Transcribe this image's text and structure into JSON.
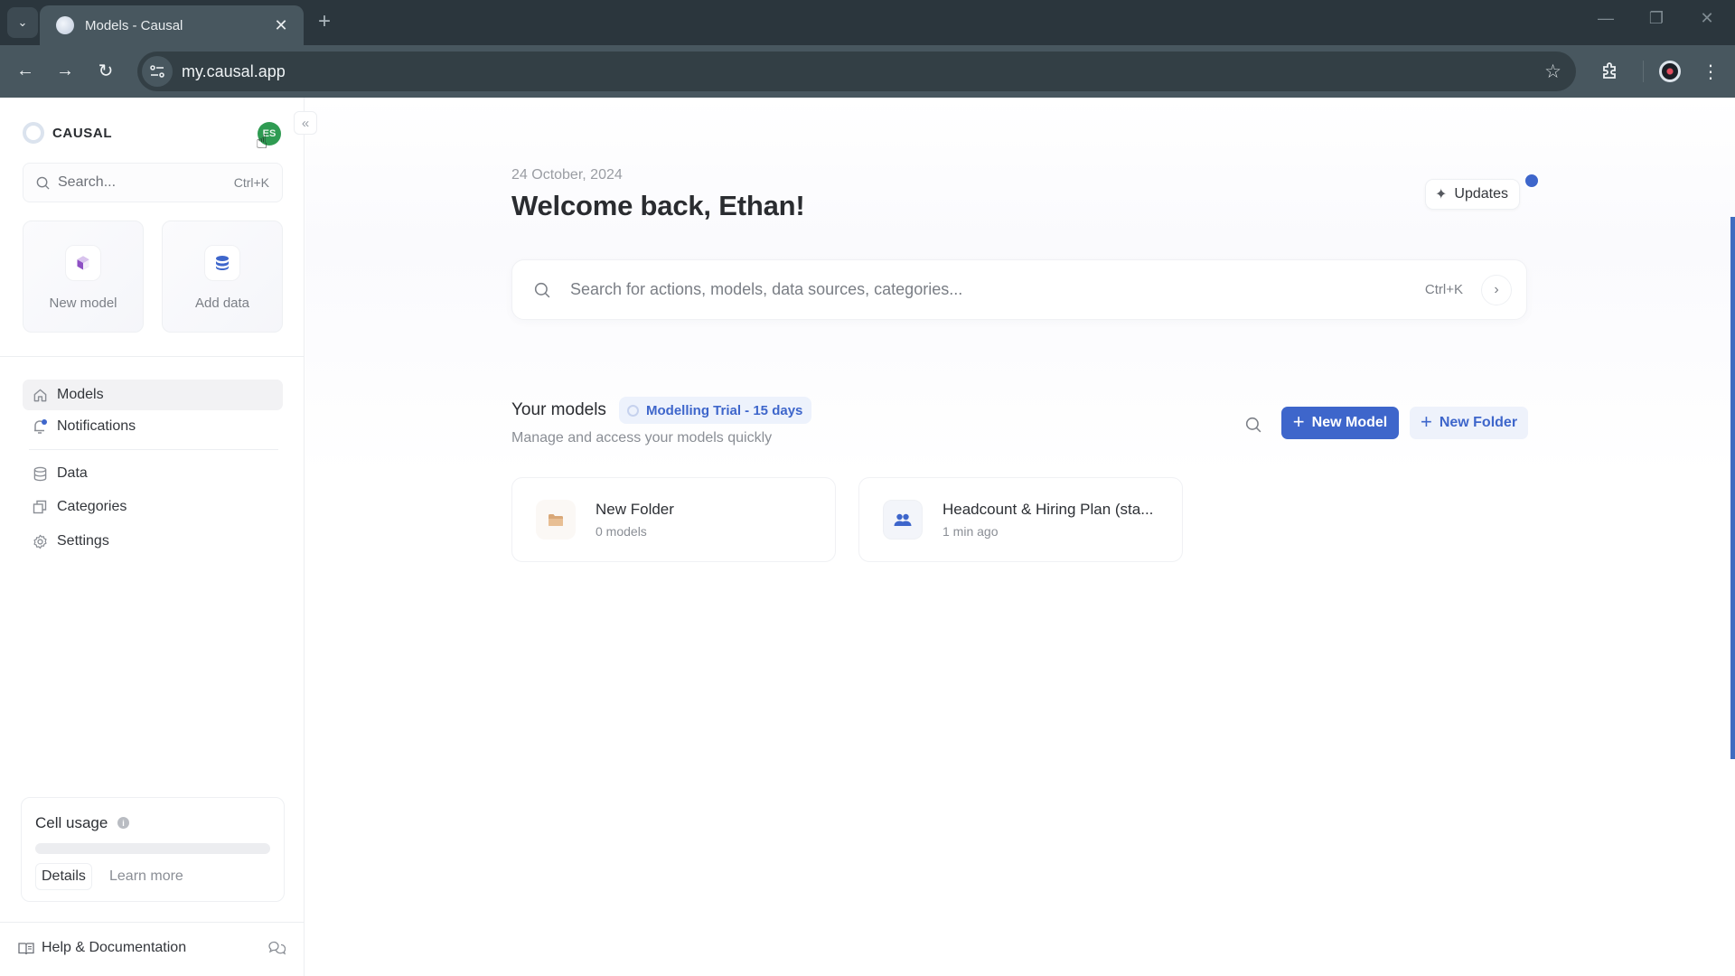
{
  "browser": {
    "tab_title": "Models - Causal",
    "url": "my.causal.app",
    "icons": {
      "tab_list": "chevron-down-icon",
      "close_tab": "close-icon",
      "new_tab": "plus-icon",
      "back": "arrow-left-icon",
      "forward": "arrow-right-icon",
      "reload": "reload-icon",
      "site_info": "tune-icon",
      "bookmark": "star-icon",
      "extensions": "puzzle-icon",
      "profile": "profile-icon",
      "menu": "kebab-menu-icon",
      "minimize": "minimize-icon",
      "restore": "restore-icon",
      "close_window": "close-icon"
    }
  },
  "sidebar": {
    "brand": "CAUSAL",
    "avatar_initials": "ES",
    "search": {
      "placeholder": "Search...",
      "shortcut": "Ctrl+K"
    },
    "quick_actions": [
      {
        "label": "New model",
        "icon": "cube-icon",
        "color": "#8e4fc4"
      },
      {
        "label": "Add data",
        "icon": "database-icon",
        "color": "#3e66cb"
      }
    ],
    "nav": [
      {
        "label": "Models",
        "icon": "home-icon",
        "active": true
      },
      {
        "label": "Notifications",
        "icon": "bell-icon",
        "badge": true
      }
    ],
    "nav_secondary": [
      {
        "label": "Data",
        "icon": "database-icon"
      },
      {
        "label": "Categories",
        "icon": "copy-icon"
      },
      {
        "label": "Settings",
        "icon": "gear-icon"
      }
    ],
    "cell_usage": {
      "title": "Cell usage",
      "progress_percent": 0,
      "details_label": "Details",
      "learn_more_label": "Learn more"
    },
    "footer": {
      "help_label": "Help & Documentation"
    }
  },
  "main": {
    "date": "24 October, 2024",
    "welcome": "Welcome back, Ethan!",
    "updates_label": "Updates",
    "search": {
      "placeholder": "Search for actions, models, data sources, categories...",
      "shortcut": "Ctrl+K"
    },
    "models_section": {
      "title": "Your models",
      "trial_badge": "Modelling Trial - 15 days",
      "subtitle": "Manage and access your models quickly",
      "new_model_label": "New Model",
      "new_folder_label": "New Folder"
    },
    "items": [
      {
        "name": "New Folder",
        "meta": "0 models",
        "type": "folder",
        "icon": "folder-icon"
      },
      {
        "name": "Headcount & Hiring Plan (sta...",
        "meta": "1 min ago",
        "type": "model",
        "icon": "people-icon"
      }
    ]
  },
  "colors": {
    "accent": "#3e66cb",
    "avatar": "#2f9b52",
    "chrome_dark": "#2b363d",
    "chrome_toolbar": "#48575f"
  }
}
